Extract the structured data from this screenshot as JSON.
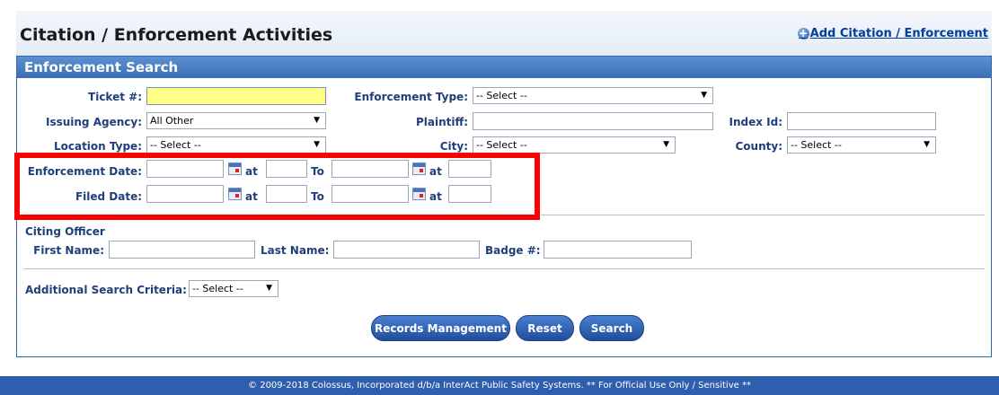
{
  "page": {
    "title": "Citation / Enforcement Activities",
    "add_link_label": "Add Citation / Enforcement"
  },
  "panel": {
    "header": "Enforcement Search"
  },
  "fields": {
    "ticket_label": "Ticket #:",
    "ticket_value": "",
    "enforcement_type_label": "Enforcement Type:",
    "enforcement_type_value": "-- Select --",
    "issuing_agency_label": "Issuing Agency:",
    "issuing_agency_value": "All Other",
    "plaintiff_label": "Plaintiff:",
    "plaintiff_value": "",
    "index_id_label": "Index Id:",
    "index_id_value": "",
    "location_type_label": "Location Type:",
    "location_type_value": "-- Select --",
    "city_label": "City:",
    "city_value": "-- Select --",
    "county_label": "County:",
    "county_value": "-- Select --",
    "enforcement_date_label": "Enforcement Date:",
    "filed_date_label": "Filed Date:",
    "at_label": "at",
    "to_label": "To"
  },
  "officer": {
    "section_title": "Citing Officer",
    "first_name_label": "First Name:",
    "last_name_label": "Last Name:",
    "badge_label": "Badge #:"
  },
  "additional": {
    "label": "Additional Search Criteria:",
    "value": "-- Select --"
  },
  "buttons": {
    "records_management": "Records Management",
    "reset": "Reset",
    "search": "Search"
  },
  "footer": {
    "text": "© 2009-2018 Colossus, Incorporated d/b/a InterAct Public Safety Systems. ** For Official Use Only / Sensitive **"
  },
  "icons": {
    "add": "plus-circle-icon",
    "calendar": "calendar-icon",
    "dropdown": "chevron-down-icon"
  },
  "colors": {
    "header_blue": "#3b6fb5",
    "label_blue": "#1f3f7a",
    "highlight_red": "#ff0000",
    "ticket_field_yellow": "#ffff88",
    "footer_blue": "#2e5eae"
  }
}
